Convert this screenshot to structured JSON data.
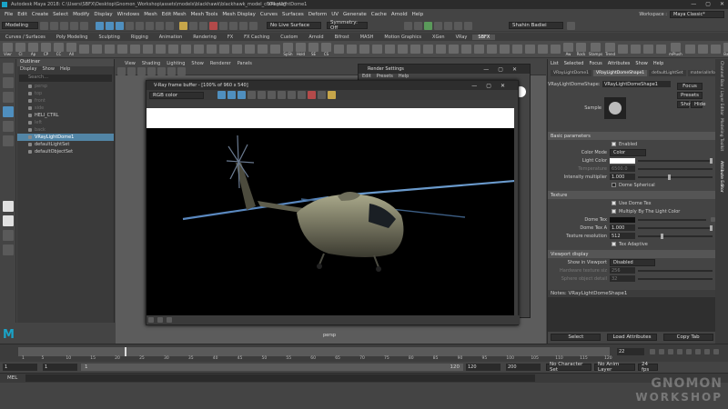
{
  "window": {
    "title": "Autodesk Maya 2018: C:\\Users\\SBFX\\Desktop\\Gnomon_Workshop\\assets\\models\\blackhawk\\blackhawk_model_c004.mb*",
    "center_title": "VRayLightDome1",
    "controls": [
      "—",
      "▢",
      "✕"
    ]
  },
  "menubar": {
    "items": [
      "File",
      "Edit",
      "Create",
      "Select",
      "Modify",
      "Display",
      "Windows",
      "Mesh",
      "Edit Mesh",
      "Mesh Tools",
      "Mesh Display",
      "Curves",
      "Surfaces",
      "Deform",
      "UV",
      "Generate",
      "Cache",
      "Arnold",
      "Help"
    ],
    "workspace_label": "Workspace :",
    "workspace_value": "Maya Classic*"
  },
  "statusline": {
    "mode": "Modeling",
    "live_surface": "No Live Surface",
    "symmetry": "Symmetry: Off",
    "user": "Shahin Badiei"
  },
  "shelf": {
    "tabs": [
      "Curves / Surfaces",
      "Poly Modeling",
      "Sculpting",
      "Rigging",
      "Animation",
      "Rendering",
      "FX",
      "FX Caching",
      "Custom",
      "Arnold",
      "Bifrost",
      "MASH",
      "Motion Graphics",
      "XGen",
      "VRay",
      "SBFX"
    ],
    "active_tab": "SBFX",
    "items": [
      "Viwr",
      "Cl",
      "Ap",
      "CP",
      "CC",
      "All",
      "",
      "",
      "",
      "",
      "",
      "",
      "",
      "",
      "",
      "",
      "",
      "",
      "",
      "",
      "",
      "",
      "SpSh",
      "Hold",
      "SE",
      "CS",
      "",
      "",
      "",
      "",
      "",
      "",
      "",
      "",
      "",
      "",
      "",
      "",
      "",
      "",
      "",
      "",
      "",
      "",
      "Aw",
      "Rock",
      "Stamps",
      "Trend",
      "",
      "",
      "",
      "",
      "mPlush",
      "",
      "",
      "",
      "Bake",
      "Zoom"
    ]
  },
  "outliner": {
    "title": "Outliner",
    "menu": [
      "Display",
      "Show",
      "Help"
    ],
    "search_placeholder": "Search...",
    "items": [
      {
        "label": "persp",
        "dim": true
      },
      {
        "label": "top",
        "dim": true
      },
      {
        "label": "front",
        "dim": true
      },
      {
        "label": "side",
        "dim": true
      },
      {
        "label": "HELI_CTRL",
        "dim": false
      },
      {
        "label": "left",
        "dim": true
      },
      {
        "label": "back",
        "dim": true
      },
      {
        "label": "VRayLightDome1",
        "dim": false,
        "selected": true
      },
      {
        "label": "defaultLightSet",
        "dim": false
      },
      {
        "label": "defaultObjectSet",
        "dim": false
      }
    ]
  },
  "viewport": {
    "menu": [
      "View",
      "Shading",
      "Lighting",
      "Show",
      "Renderer",
      "Panels"
    ],
    "camera_label": "persp"
  },
  "vfb": {
    "title": "V-Ray frame buffer - [100% of 960 x 540]",
    "channel": "RGB color"
  },
  "render_settings": {
    "title": "Render Settings",
    "menu": [
      "Edit",
      "Presets",
      "Help"
    ]
  },
  "attribute_editor": {
    "menu": [
      "List",
      "Selected",
      "Focus",
      "Attributes",
      "Show",
      "Help"
    ],
    "tabs": [
      "VRayLightDome1",
      "VRayLightDomeShape1",
      "defaultLightSet",
      "materialInfo"
    ],
    "node_label": "VRayLightDomeShape:",
    "node_value": "VRayLightDomeShape1",
    "buttons": {
      "focus": "Focus",
      "presets": "Presets",
      "show": "Show",
      "hide": "Hide"
    },
    "sample_label": "Sample",
    "basic_section": "Basic parameters",
    "enabled_label": "Enabled",
    "color_mode_label": "Color Mode",
    "color_mode_value": "Color",
    "light_color_label": "Light Color",
    "temperature_label": "Temperature",
    "temperature_value": "6500.0",
    "intensity_label": "Intensity multiplier",
    "intensity_value": "1.000",
    "dome_spherical_label": "Dome Spherical",
    "texture_section": "Texture",
    "use_dome_tex_label": "Use Dome Tex",
    "multiply_label": "Multiply By The Light Color",
    "dome_tex_label": "Dome Tex",
    "dome_tex_a_label": "Dome Tex A",
    "dome_tex_a_value": "1.000",
    "texture_res_label": "Texture resolution",
    "texture_res_value": "512",
    "tex_adaptive_label": "Tex Adaptive",
    "viewport_section": "Viewport display",
    "show_in_viewport_label": "Show in Viewport",
    "show_in_viewport_value": "Disabled",
    "hw_texture_label": "Hardware texture siz",
    "hw_texture_value": "256",
    "sphere_detail_label": "Sphere object detail",
    "sphere_detail_value": "32",
    "notes_label": "Notes: VRayLightDomeShape1",
    "bottom_buttons": [
      "Select",
      "Load Attributes",
      "Copy Tab"
    ]
  },
  "side_tabs": [
    "Attribute Editor",
    "Channel Box / Layer Editor",
    "Modeling Toolkit"
  ],
  "timeline": {
    "ticks": [
      "1",
      "5",
      "10",
      "15",
      "20",
      "25",
      "30",
      "35",
      "40",
      "45",
      "50",
      "55",
      "60",
      "65",
      "70",
      "75",
      "80",
      "85",
      "90",
      "95",
      "100",
      "105",
      "110",
      "115",
      "120"
    ],
    "current_frame": "22",
    "current_frame_marker": 22
  },
  "range": {
    "start": "1",
    "start2": "1",
    "inner_start": "1",
    "inner_end": "120",
    "end": "120",
    "end2": "200",
    "character_set": "No Character Set",
    "anim_layer": "No Anim Layer",
    "fps": "24 fps"
  },
  "cmdline": {
    "label": "MEL"
  },
  "watermark": {
    "line1": "GNOMON",
    "line2": "WORKSHOP"
  },
  "colors": {
    "selection": "#5285a6",
    "background": "#444444",
    "render_bg": "#000000"
  }
}
